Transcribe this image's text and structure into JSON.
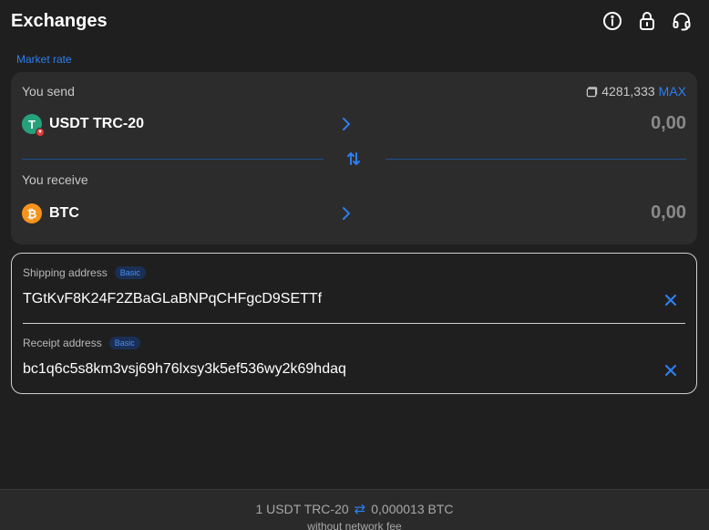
{
  "header": {
    "title": "Exchanges",
    "icons": [
      "info-icon",
      "lock-icon",
      "support-headset-icon"
    ]
  },
  "market_rate_label": "Market rate",
  "send": {
    "label": "You send",
    "balance": "4281,333",
    "max_label": "MAX",
    "asset": "USDT TRC-20",
    "amount": "0,00"
  },
  "receive": {
    "label": "You receive",
    "asset": "BTC",
    "amount": "0,00"
  },
  "addresses": {
    "shipping": {
      "label": "Shipping address",
      "badge": "Basic",
      "value": "TGtKvF8K24F2ZBaGLaBNPqCHFgcD9SETTf"
    },
    "receipt": {
      "label": "Receipt address",
      "badge": "Basic",
      "value": "bc1q6c5s8km3vsj69h76lxsy3k5ef536wy2k69hdaq"
    }
  },
  "footer": {
    "from": "1 USDT TRC-20",
    "to": "0,000013 BTC",
    "note": "without network fee"
  },
  "colors": {
    "background": "#1f1f1f",
    "card": "#2c2c2c",
    "accent": "#2d7ff0",
    "usdt": "#26a17b",
    "btc": "#f7931a"
  }
}
